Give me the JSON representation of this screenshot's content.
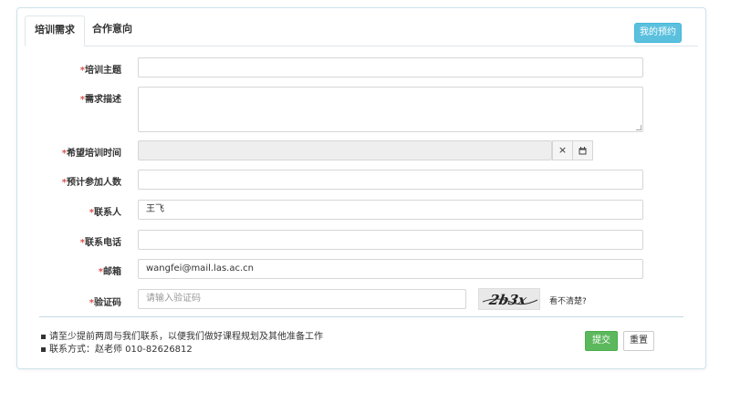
{
  "tabs": [
    {
      "label": "培训需求",
      "active": true
    },
    {
      "label": "合作意向",
      "active": false
    }
  ],
  "my_appointments_label": "我的预约",
  "required_mark": "*",
  "fields": {
    "training_topic": {
      "label": "培训主题",
      "value": ""
    },
    "description": {
      "label": "需求描述",
      "value": ""
    },
    "preferred_time": {
      "label": "希望培训时间",
      "value": "",
      "clear_icon": "×",
      "calendar_icon": "calendar"
    },
    "participants": {
      "label": "预计参加人数",
      "value": ""
    },
    "contact": {
      "label": "联系人",
      "value": "王飞"
    },
    "phone": {
      "label": "联系电话",
      "value": ""
    },
    "email": {
      "label": "邮箱",
      "value": "wangfei@mail.las.ac.cn"
    },
    "captcha": {
      "label": "验证码",
      "value": "",
      "placeholder": "请输入验证码",
      "captcha_text": "2b3x",
      "refresh_link": "看不清楚?"
    }
  },
  "notes": [
    "请至少提前两周与我们联系，以便我们做好课程规划及其他准备工作",
    "联系方式：赵老师 010-82626812"
  ],
  "buttons": {
    "submit": "提交",
    "reset": "重置"
  },
  "colors": {
    "accent_info": "#5bc0de",
    "submit_green": "#5cb85c",
    "required_red": "#d9534f"
  }
}
